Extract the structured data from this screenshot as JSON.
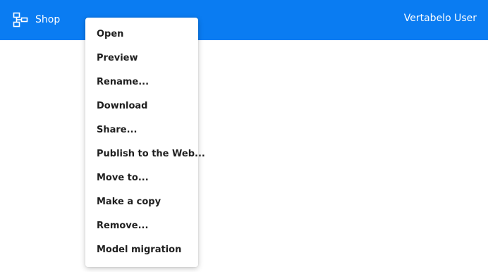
{
  "header": {
    "brand_label": "Shop",
    "brand_icon": "diagram-icon",
    "user_label": "Vertabelo User",
    "background_color": "#0a7cf2"
  },
  "context_menu": {
    "items": [
      "Open",
      "Preview",
      "Rename...",
      "Download",
      "Share...",
      "Publish to the Web...",
      "Move to...",
      "Make a copy",
      "Remove...",
      "Model migration"
    ]
  }
}
